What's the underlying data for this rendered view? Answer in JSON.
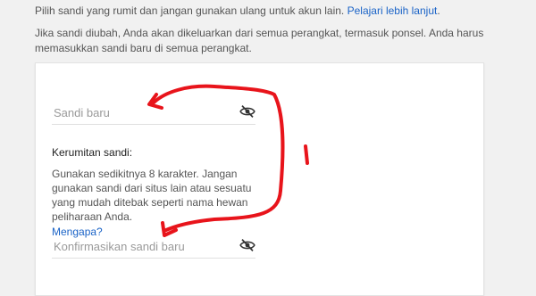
{
  "intro": {
    "line1_text": "Pilih sandi yang rumit dan jangan gunakan ulang untuk akun lain.",
    "learn_more_link": "Pelajari lebih lanjut",
    "line1_end": ".",
    "line2_text": "Jika sandi diubah, Anda akan dikeluarkan dari semua perangkat, termasuk ponsel. Anda harus memasukkan sandi baru di semua perangkat."
  },
  "form": {
    "new_password": {
      "placeholder": "Sandi baru",
      "icon": "eye-off-icon"
    },
    "strength": {
      "title": "Kerumitan sandi:",
      "body": "Gunakan sedikitnya 8 karakter. Jangan gunakan sandi dari situs lain atau sesuatu yang mudah ditebak seperti nama hewan peliharaan Anda.",
      "why_link": "Mengapa?"
    },
    "confirm_password": {
      "placeholder": "Konfirmasikan sandi baru",
      "icon": "eye-off-icon"
    }
  },
  "annotation": {
    "color": "#e8141b"
  }
}
